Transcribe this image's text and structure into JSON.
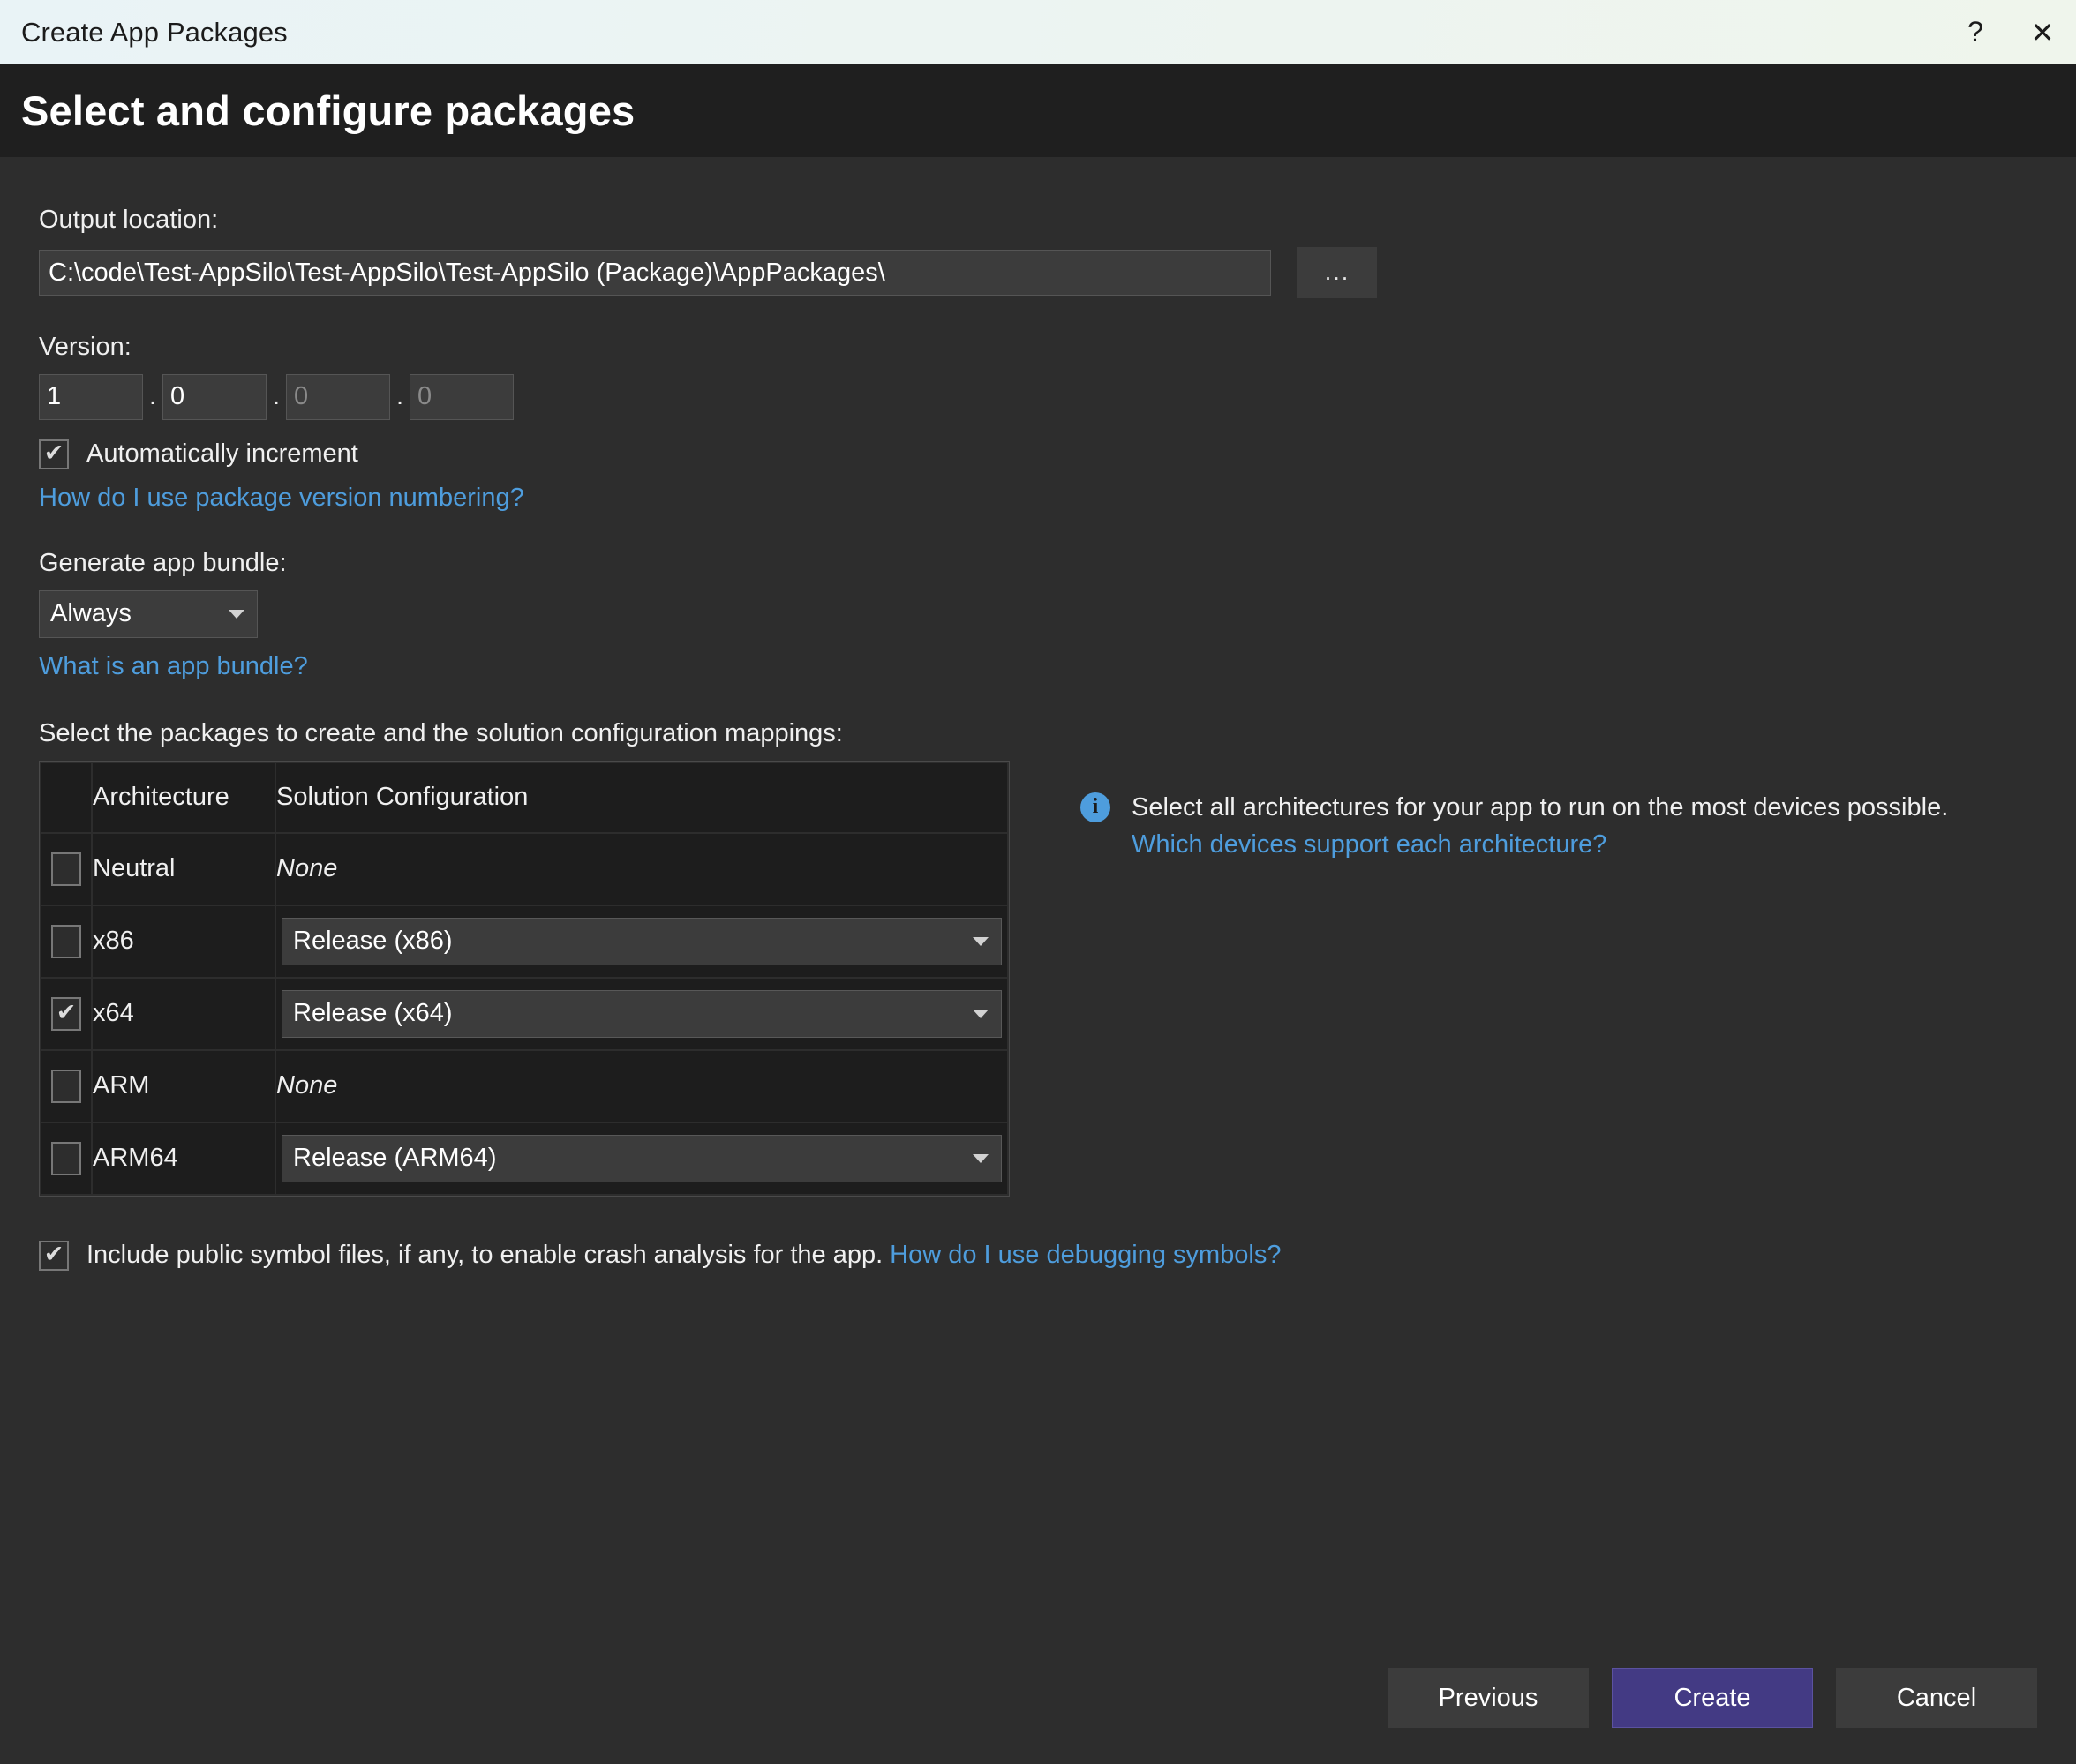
{
  "window": {
    "title": "Create App Packages",
    "help_icon": "?",
    "close_icon": "✕"
  },
  "header": {
    "title": "Select and configure packages"
  },
  "output": {
    "label": "Output location:",
    "path": "C:\\code\\Test-AppSilo\\Test-AppSilo\\Test-AppSilo (Package)\\AppPackages\\",
    "browse_label": "..."
  },
  "version": {
    "label": "Version:",
    "major": "1",
    "minor": "0",
    "build": "0",
    "revision": "0",
    "separator": ".",
    "auto_increment": {
      "label": "Automatically increment",
      "checked": true,
      "tick": "✔"
    },
    "help_link": "How do I use package version numbering?"
  },
  "bundle": {
    "label": "Generate app bundle:",
    "selected": "Always",
    "help_link": "What is an app bundle?"
  },
  "packages": {
    "label": "Select the packages to create and the solution configuration mappings:",
    "columns": [
      "",
      "Architecture",
      "Solution Configuration"
    ],
    "rows": [
      {
        "checked": false,
        "tick": "✔",
        "architecture": "Neutral",
        "configuration": "None",
        "config_type": "none"
      },
      {
        "checked": false,
        "tick": "✔",
        "architecture": "x86",
        "configuration": "Release (x86)",
        "config_type": "select"
      },
      {
        "checked": true,
        "tick": "✔",
        "architecture": "x64",
        "configuration": "Release (x64)",
        "config_type": "select"
      },
      {
        "checked": false,
        "tick": "✔",
        "architecture": "ARM",
        "configuration": "None",
        "config_type": "none"
      },
      {
        "checked": false,
        "tick": "✔",
        "architecture": "ARM64",
        "configuration": "Release (ARM64)",
        "config_type": "select"
      }
    ]
  },
  "info": {
    "icon": "i",
    "text": "Select all architectures for your app to run on the most devices possible.",
    "link": "Which devices support each architecture?"
  },
  "symbols": {
    "checked": true,
    "tick": "✔",
    "text": "Include public symbol files, if any, to enable crash analysis for the app.",
    "link": "How do I use debugging symbols?"
  },
  "footer": {
    "previous": "Previous",
    "create": "Create",
    "cancel": "Cancel"
  },
  "colors": {
    "accent": "#433a84",
    "link": "#4e9ddd",
    "info": "#4e9ddd",
    "background": "#2d2d2d",
    "header_band": "#1f1f1f",
    "titlebar_start": "#e9f3f6",
    "titlebar_end": "#eff5ec"
  }
}
